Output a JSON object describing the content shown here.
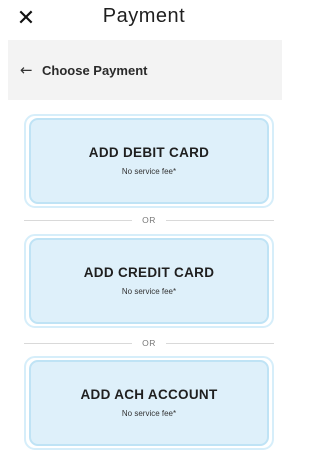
{
  "header": {
    "title": "Payment",
    "close_glyph": "✕"
  },
  "subheader": {
    "back_glyph": "←",
    "label": "Choose Payment"
  },
  "options": [
    {
      "title": "ADD DEBIT CARD",
      "subtitle": "No service fee*"
    },
    {
      "title": "ADD CREDIT CARD",
      "subtitle": "No service fee*"
    },
    {
      "title": "ADD ACH ACCOUNT",
      "subtitle": "No service fee*"
    }
  ],
  "divider_label": "OR",
  "colors": {
    "card_fill": "#def0fa",
    "card_outline": "#bfe3f5",
    "panel_background": "#f3f3f3"
  },
  "icons": {
    "close": "close-icon",
    "back": "arrow-left-icon"
  }
}
